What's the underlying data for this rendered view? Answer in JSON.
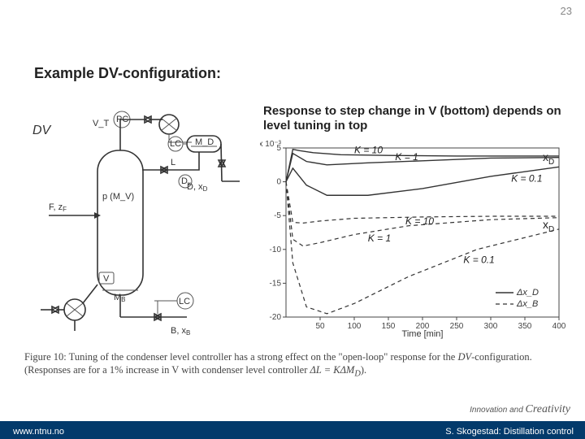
{
  "page_number": "23",
  "title": "Example DV-configuration:",
  "right_caption": "Response to step change in V (bottom) depends on level tuning in top",
  "fig_caption_prefix": "Figure 10: Tuning of the condenser level controller has a strong effect on the \"open-loop\" response for the ",
  "fig_caption_dv": "DV",
  "fig_caption_mid": "-configuration. (Responses are for a 1% increase in V with condenser level controller ",
  "fig_caption_eq": "ΔL = KΔM_D",
  "fig_caption_end": ").",
  "footer_url": "www.ntnu.no",
  "tagline_left": "Innovation and ",
  "tagline_right": "Creativity",
  "footer_right": "S. Skogestad: Distillation control",
  "xd_labels": {
    "top": "x",
    "top_sub": "D",
    "bot": "x",
    "bot_sub": "D"
  },
  "diagram_labels": {
    "DV": "DV",
    "VT": "V_T",
    "PC": "PC",
    "LC_top": "LC",
    "MD": "M_D",
    "L": "L",
    "D_xD": "D, x_D",
    "Dv": "D_V",
    "F_zF": "F, z_F",
    "p_MV": "p (M_V)",
    "V": "V",
    "MB": "M_B",
    "LC_bot": "LC",
    "B_xB": "B, x_B"
  },
  "chart_data": {
    "type": "line",
    "xlabel": "Time [min]",
    "ylabel_note": "x 10⁻³",
    "xlim": [
      0,
      400
    ],
    "ylim": [
      -20,
      5
    ],
    "x_ticks": [
      50,
      100,
      150,
      200,
      250,
      300,
      350,
      400
    ],
    "y_ticks": [
      5,
      0,
      -5,
      -10,
      -15,
      -20
    ],
    "legend": [
      "Δx_D",
      "Δx_B"
    ],
    "series": [
      {
        "name": "Δx_D K=10",
        "dashed": false,
        "K_label": "K = 10",
        "x": [
          0,
          10,
          20,
          40,
          80,
          150,
          250,
          400
        ],
        "y": [
          0,
          4.8,
          4.6,
          4.3,
          4.0,
          3.9,
          3.8,
          3.8
        ]
      },
      {
        "name": "Δx_D K=1",
        "dashed": false,
        "K_label": "K = 1",
        "x": [
          0,
          10,
          30,
          60,
          120,
          200,
          300,
          400
        ],
        "y": [
          0,
          4.2,
          3.0,
          2.5,
          2.8,
          3.1,
          3.5,
          3.6
        ]
      },
      {
        "name": "Δx_D K=0.1",
        "dashed": false,
        "K_label": "K = 0.1",
        "x": [
          0,
          10,
          30,
          60,
          120,
          200,
          300,
          400
        ],
        "y": [
          0,
          2.0,
          -0.5,
          -2.0,
          -2.0,
          -1.0,
          0.8,
          2.2
        ]
      },
      {
        "name": "Δx_B K=10",
        "dashed": true,
        "K_label": "K = 10",
        "x": [
          0,
          10,
          25,
          50,
          100,
          200,
          300,
          400
        ],
        "y": [
          0,
          -6.0,
          -6.1,
          -5.8,
          -5.4,
          -5.2,
          -5.1,
          -5.1
        ]
      },
      {
        "name": "Δx_B K=1",
        "dashed": true,
        "K_label": "K = 1",
        "x": [
          0,
          10,
          25,
          50,
          100,
          180,
          300,
          400
        ],
        "y": [
          0,
          -8.5,
          -9.5,
          -9.0,
          -7.8,
          -6.5,
          -5.6,
          -5.3
        ]
      },
      {
        "name": "Δx_B K=0.1",
        "dashed": true,
        "K_label": "K = 0.1",
        "x": [
          0,
          10,
          30,
          60,
          100,
          180,
          280,
          400
        ],
        "y": [
          0,
          -12,
          -18.5,
          -19.5,
          -18,
          -14,
          -10,
          -7
        ]
      }
    ],
    "curve_annotations": [
      {
        "text": "K = 10",
        "x": 100,
        "y": 4.2
      },
      {
        "text": "K = 1",
        "x": 160,
        "y": 3.2
      },
      {
        "text": "K = 0.1",
        "x": 330,
        "y": 0.0
      },
      {
        "text": "K = 10",
        "x": 175,
        "y": -6.3
      },
      {
        "text": "K = 1",
        "x": 120,
        "y": -8.8
      },
      {
        "text": "K = 0.1",
        "x": 260,
        "y": -12
      }
    ]
  }
}
